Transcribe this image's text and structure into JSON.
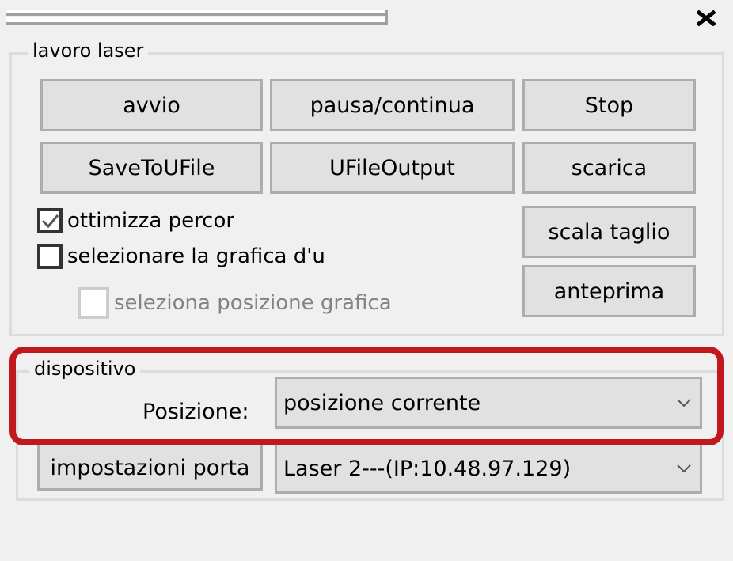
{
  "window": {
    "close_icon": "close-icon"
  },
  "laser_job": {
    "title": "lavoro laser",
    "buttons": {
      "start": "avvio",
      "pause_resume": "pausa/continua",
      "stop": "Stop",
      "save_to_ufile": "SaveToUFile",
      "ufile_output": "UFileOutput",
      "download": "scarica",
      "cut_scale": "scala taglio",
      "preview": "anteprima"
    },
    "checkboxes": [
      {
        "label": "ottimizza percor",
        "checked": true,
        "enabled": true
      },
      {
        "label": "selezionare la grafica d'u",
        "checked": false,
        "enabled": true
      },
      {
        "label": "seleziona posizione grafica",
        "checked": false,
        "enabled": false
      }
    ]
  },
  "device": {
    "title": "dispositivo",
    "position_label": "Posizione:",
    "position_value": "posizione corrente",
    "port_settings_button": "impostazioni porta",
    "device_value": "Laser 2---(IP:10.48.97.129)"
  },
  "highlight_color": "#c0181c"
}
